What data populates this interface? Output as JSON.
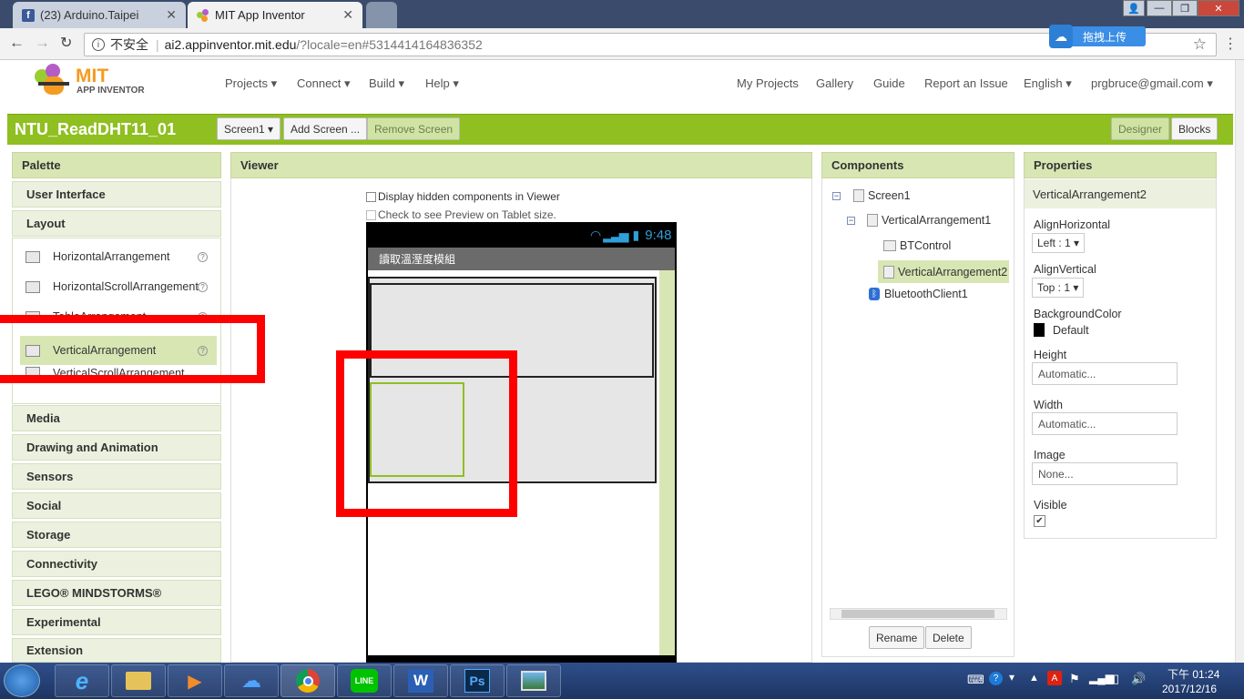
{
  "browser": {
    "tabs": [
      {
        "title": "(23) Arduino.Taipei",
        "icon": "facebook-icon"
      },
      {
        "title": "MIT App Inventor",
        "icon": "appinventor-icon"
      }
    ],
    "security_label": "不安全",
    "url_host": "ai2.appinventor.mit.edu",
    "url_rest": "/?locale=en#5314414164836352",
    "upload_button": "拖拽上传"
  },
  "header": {
    "logo_mit": "MIT",
    "logo_sub": "APP INVENTOR",
    "menus": [
      "Projects ▾",
      "Connect ▾",
      "Build ▾",
      "Help ▾"
    ],
    "right_links": [
      "My Projects",
      "Gallery",
      "Guide",
      "Report an Issue",
      "English ▾",
      "prgbruce@gmail.com ▾"
    ]
  },
  "toolbar": {
    "project_name": "NTU_ReadDHT11_01",
    "screen_select": "Screen1 ▾",
    "add_screen": "Add Screen ...",
    "remove_screen": "Remove Screen",
    "designer": "Designer",
    "blocks": "Blocks"
  },
  "palette": {
    "title": "Palette",
    "categories_top": [
      "User Interface",
      "Layout"
    ],
    "layout_items": [
      "HorizontalArrangement",
      "HorizontalScrollArrangement",
      "TableArrangement",
      "VerticalArrangement",
      "VerticalScrollArrangement"
    ],
    "categories_bottom": [
      "Media",
      "Drawing and Animation",
      "Sensors",
      "Social",
      "Storage",
      "Connectivity",
      "LEGO® MINDSTORMS®",
      "Experimental",
      "Extension"
    ]
  },
  "viewer": {
    "title": "Viewer",
    "check_hidden": "Display hidden components in Viewer",
    "check_tablet": "Check to see Preview on Tablet size.",
    "phone_time": "9:48",
    "app_title": "讀取溫溼度模組"
  },
  "components": {
    "title": "Components",
    "tree": [
      "Screen1",
      "VerticalArrangement1",
      "BTControl",
      "VerticalArrangement2",
      "BluetoothClient1"
    ],
    "rename": "Rename",
    "delete": "Delete"
  },
  "properties": {
    "title": "Properties",
    "selected": "VerticalArrangement2",
    "align_horizontal_label": "AlignHorizontal",
    "align_horizontal_value": "Left : 1 ▾",
    "align_vertical_label": "AlignVertical",
    "align_vertical_value": "Top : 1 ▾",
    "bgcolor_label": "BackgroundColor",
    "bgcolor_value": "Default",
    "height_label": "Height",
    "height_value": "Automatic...",
    "width_label": "Width",
    "width_value": "Automatic...",
    "image_label": "Image",
    "image_value": "None...",
    "visible_label": "Visible",
    "visible_checked": true
  },
  "taskbar": {
    "apps": [
      "ie-icon",
      "explorer-icon",
      "media-icon",
      "baidu-cloud-icon",
      "chrome-icon",
      "line-icon",
      "word-icon",
      "photoshop-icon",
      "image-viewer-icon"
    ],
    "time": "下午 01:24",
    "date": "2017/12/16"
  },
  "colors": {
    "accent_green": "#8fbf21",
    "highlight": "#f00"
  }
}
